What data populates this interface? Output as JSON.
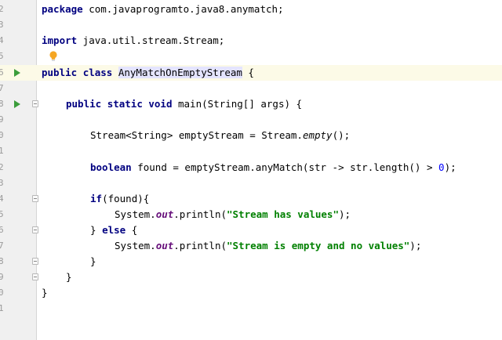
{
  "editor": {
    "line_numbers": [
      "2",
      "3",
      "4",
      "5",
      "6",
      "7",
      "8",
      "9",
      "0",
      "1",
      "2",
      "3",
      "4",
      "5",
      "6",
      "7",
      "8",
      "9",
      "0",
      "1"
    ],
    "icons": {
      "run": "run-gutter-icon",
      "fold": "fold-marker-icon",
      "intention": "lightbulb-icon"
    },
    "code": {
      "l2": [
        "package",
        " com.javaprogramto.java8.anymatch;"
      ],
      "l4": [
        "import",
        " java.util.stream.Stream;"
      ],
      "l6": [
        "public",
        " ",
        "class",
        " ",
        "AnyMatchOnEmptyStream",
        " {"
      ],
      "l8": [
        "public",
        " ",
        "static",
        " ",
        "void",
        " main(String[] args) {"
      ],
      "l10": [
        "Stream<String> emptyStream = Stream.",
        "empty",
        "();"
      ],
      "l12": [
        "boolean",
        " found = emptyStream.anyMatch(str -> str.length() > ",
        "0",
        ");"
      ],
      "l14": [
        "if",
        "(found){"
      ],
      "l15": [
        "System.",
        "out",
        ".println(",
        "\"Stream has values\"",
        ");"
      ],
      "l16": [
        "} ",
        "else",
        " {"
      ],
      "l17": [
        "System.",
        "out",
        ".println(",
        "\"Stream is empty and no values\"",
        ");"
      ],
      "l18": [
        "}"
      ],
      "l19": [
        "}"
      ],
      "l20": [
        "}"
      ]
    }
  }
}
